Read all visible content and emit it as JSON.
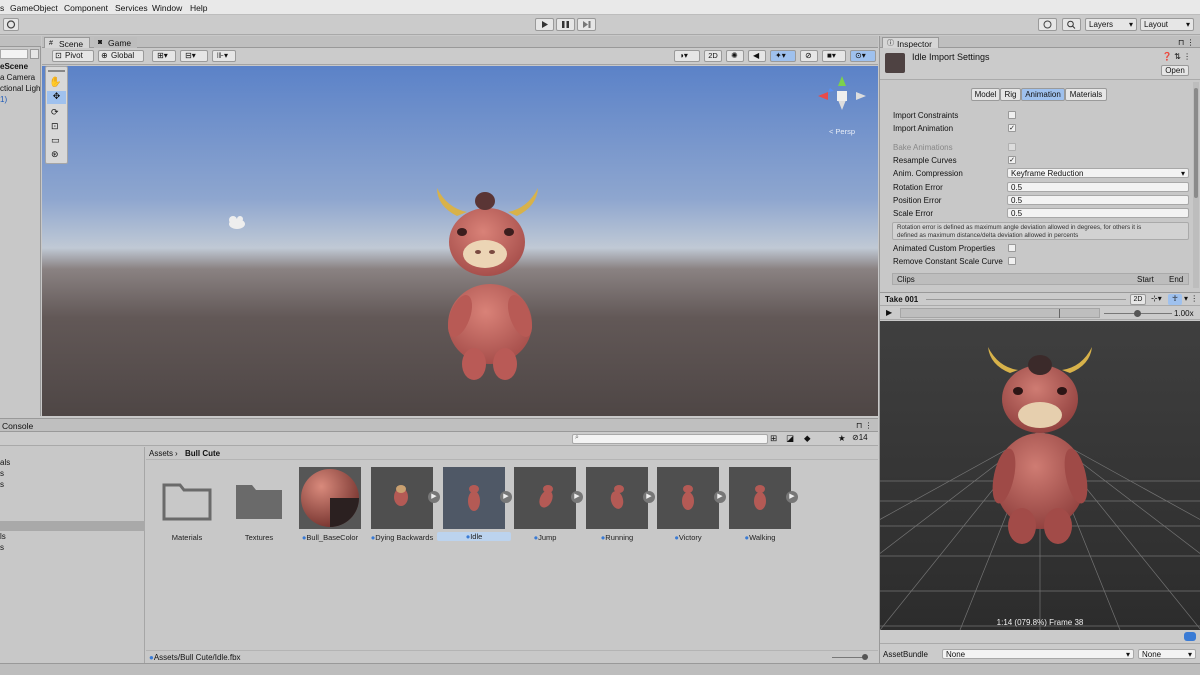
{
  "menu": [
    "GameObject",
    "Component",
    "Services",
    "Window",
    "Help"
  ],
  "toolbar": {
    "layers_label": "Layers",
    "layout_label": "Layout"
  },
  "hierarchy": {
    "items": [
      "eScene",
      "a Camera",
      "ctional Ligh",
      "1)"
    ]
  },
  "scene": {
    "tabs": [
      "Scene",
      "Game"
    ],
    "pivot_label": "Pivot",
    "global_label": "Global",
    "mode_2d": "2D",
    "persp_label": "< Persp"
  },
  "project": {
    "console_tab": "Console",
    "left_items": [
      "als",
      "s",
      "s",
      "ls",
      "s"
    ],
    "breadcrumb_root": "Assets",
    "breadcrumb_current": "Bull Cute",
    "count": "14",
    "assets": [
      {
        "name": "Materials",
        "type": "folder"
      },
      {
        "name": "Textures",
        "type": "folder"
      },
      {
        "name": "Bull_BaseColor",
        "type": "material"
      },
      {
        "name": "Dying Backwards",
        "type": "clip"
      },
      {
        "name": "Idle",
        "type": "clip"
      },
      {
        "name": "Jump",
        "type": "clip"
      },
      {
        "name": "Running",
        "type": "clip"
      },
      {
        "name": "Victory",
        "type": "clip"
      },
      {
        "name": "Walking",
        "type": "clip"
      }
    ],
    "status_path": "Assets/Bull Cute/Idle.fbx"
  },
  "inspector": {
    "tab": "Inspector",
    "title": "Idle Import Settings",
    "open_label": "Open",
    "subtabs": [
      "Model",
      "Rig",
      "Animation",
      "Materials"
    ],
    "active_subtab": "Animation",
    "rows": {
      "import_constraints": "Import Constraints",
      "import_animation": "Import Animation",
      "bake_animations": "Bake Animations",
      "resample_curves": "Resample Curves",
      "anim_compression": "Anim. Compression",
      "anim_compression_value": "Keyframe Reduction",
      "rotation_error": "Rotation Error",
      "rotation_error_value": "0.5",
      "position_error": "Position Error",
      "position_error_value": "0.5",
      "scale_error": "Scale Error",
      "scale_error_value": "0.5",
      "help_text_1": "Rotation error is defined as maximum angle deviation allowed in degrees, for others it is",
      "help_text_2": "defined as maximum distance/delta deviation allowed in percents",
      "animated_custom": "Animated Custom Properties",
      "remove_constant": "Remove Constant Scale Curve"
    },
    "clips_header": "Clips",
    "clips_start": "Start",
    "clips_end": "End",
    "preview_title": "Take 001",
    "preview_2d": "2D",
    "speed": "1.00x",
    "frame_info": "1:14 (079.8%) Frame 38",
    "assetbundle_label": "AssetBundle",
    "assetbundle_value": "None",
    "assetbundle_variant": "None"
  },
  "colors": {
    "accent": "#3a7bd5",
    "selected": "#bcd3ee",
    "sky_top": "#5d84c9",
    "sky_horizon": "#b7c3d3",
    "ground": "#5a5150"
  }
}
